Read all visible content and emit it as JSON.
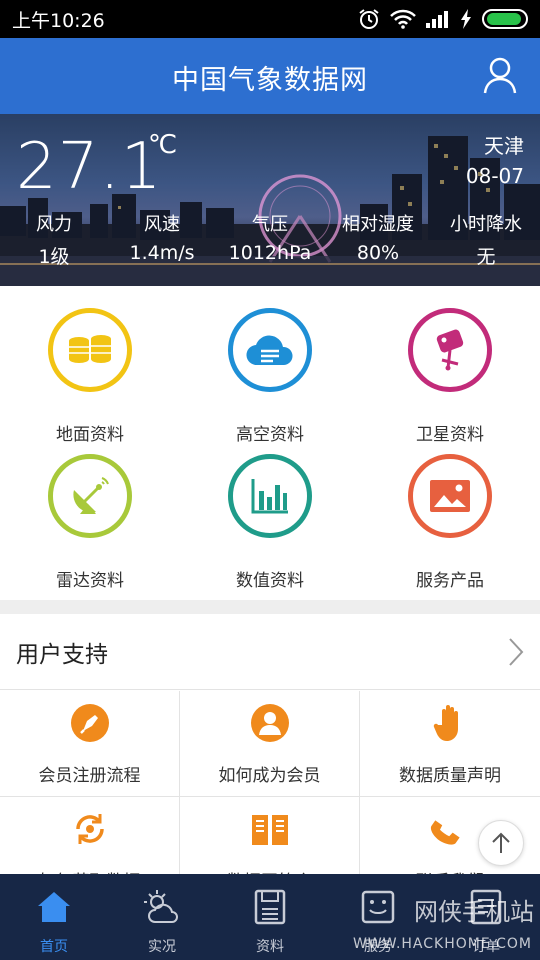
{
  "status_bar": {
    "time": "上午10:26"
  },
  "app": {
    "title": "中国气象数据网"
  },
  "weather": {
    "temperature": "27.1",
    "unit": "℃",
    "city": "天津",
    "date": "08-07",
    "stats": [
      {
        "label": "风力",
        "value": "1级"
      },
      {
        "label": "风速",
        "value": "1.4m/s"
      },
      {
        "label": "气压",
        "value": "1012hPa"
      },
      {
        "label": "相对湿度",
        "value": "80%"
      },
      {
        "label": "小时降水",
        "value": "无"
      }
    ]
  },
  "categories": [
    {
      "label": "地面资料",
      "color": "#f2c414",
      "icon": "database-icon"
    },
    {
      "label": "高空资料",
      "color": "#1e8fd6",
      "icon": "cloud-icon"
    },
    {
      "label": "卫星资料",
      "color": "#c22b7a",
      "icon": "satellite-icon"
    },
    {
      "label": "雷达资料",
      "color": "#a8c93a",
      "icon": "radar-dish-icon"
    },
    {
      "label": "数值资料",
      "color": "#1f9c8a",
      "icon": "bar-chart-icon"
    },
    {
      "label": "服务产品",
      "color": "#e7603f",
      "icon": "image-icon"
    }
  ],
  "support": {
    "title": "用户支持",
    "items": [
      {
        "label": "会员注册流程",
        "icon": "pen-icon"
      },
      {
        "label": "如何成为会员",
        "icon": "user-icon"
      },
      {
        "label": "数据质量声明",
        "icon": "hand-icon"
      },
      {
        "label": "如何获取数据",
        "icon": "refresh-icon"
      },
      {
        "label": "数据网简介",
        "icon": "book-icon"
      },
      {
        "label": "联系我们",
        "icon": "phone-icon"
      }
    ],
    "accent_color": "#f08a1c"
  },
  "tabs": [
    {
      "label": "首页",
      "icon": "home-icon",
      "active": true
    },
    {
      "label": "实况",
      "icon": "weather-icon",
      "active": false
    },
    {
      "label": "资料",
      "icon": "save-icon",
      "active": false
    },
    {
      "label": "服务",
      "icon": "service-icon",
      "active": false
    },
    {
      "label": "订单",
      "icon": "order-icon",
      "active": false
    }
  ],
  "watermark": {
    "brand": "网侠手机站",
    "url": "WWW.HACKHOME.COM"
  }
}
